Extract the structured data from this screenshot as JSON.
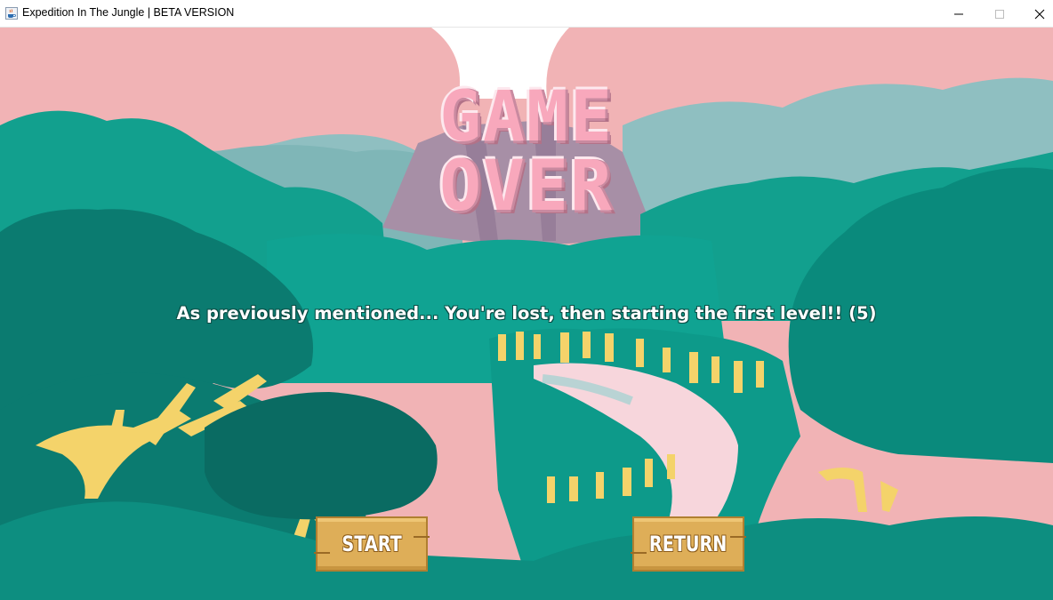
{
  "window": {
    "title": "Expedition In The Jungle | BETA VERSION",
    "icon": "java-cup-icon",
    "controls": [
      "minimize-icon",
      "maximize-icon",
      "close-icon"
    ]
  },
  "game_over": {
    "line1": "GAME",
    "line2": "OVER"
  },
  "message": "As previously mentioned... You're lost, then starting the first level!! (5)",
  "buttons": {
    "start": "START",
    "return": "RETURN"
  },
  "colors": {
    "sky": "#f1b3b5",
    "far_hills": "#8fbfc1",
    "jungle": "#0f9c8c",
    "dark_jungle": "#0a6b62",
    "path": "#f7d6dc",
    "trees": "#f4d36a",
    "title_pink": "#f8a8bc",
    "sign": "#deae58"
  }
}
